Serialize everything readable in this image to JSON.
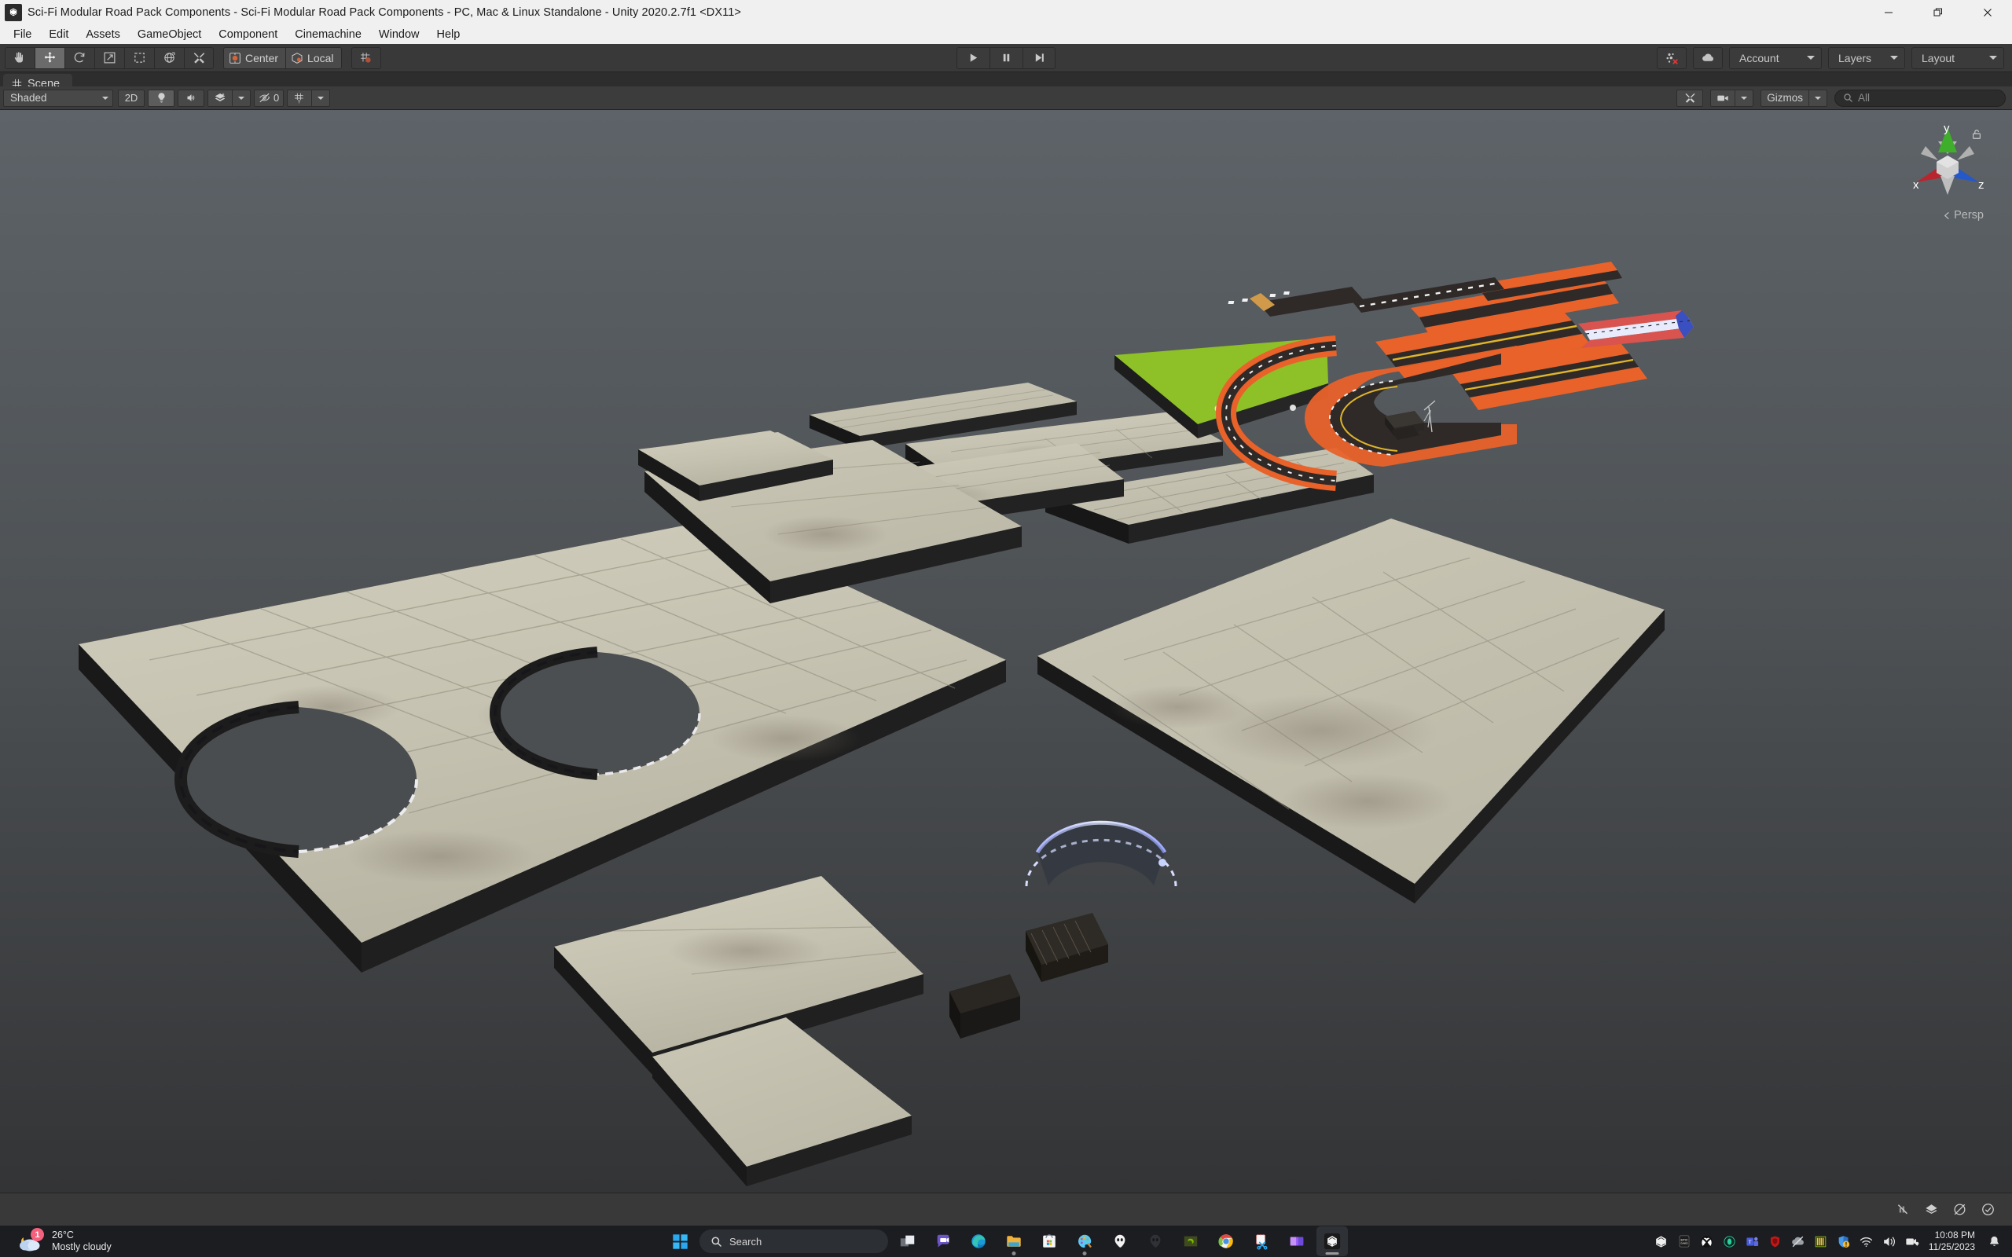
{
  "window": {
    "title": "Sci-Fi Modular Road Pack Components - Sci-Fi Modular Road Pack Components - PC, Mac & Linux Standalone - Unity 2020.2.7f1 <DX11>",
    "app_icon": "unity-icon",
    "controls": {
      "minimize": "minimize-icon",
      "restore": "restore-icon",
      "close": "close-icon"
    }
  },
  "menubar": {
    "items": [
      {
        "label": "File"
      },
      {
        "label": "Edit"
      },
      {
        "label": "Assets"
      },
      {
        "label": "GameObject"
      },
      {
        "label": "Component"
      },
      {
        "label": "Cinemachine"
      },
      {
        "label": "Window"
      },
      {
        "label": "Help"
      }
    ]
  },
  "toolbar": {
    "transform_tools": [
      {
        "name": "hand-tool",
        "icon": "hand-icon",
        "active": false
      },
      {
        "name": "move-tool",
        "icon": "move-icon",
        "active": true
      },
      {
        "name": "rotate-tool",
        "icon": "rotate-icon",
        "active": false
      },
      {
        "name": "scale-tool",
        "icon": "scale-icon",
        "active": false
      },
      {
        "name": "rect-tool",
        "icon": "rect-icon",
        "active": false
      },
      {
        "name": "transform-tool",
        "icon": "transform-icon",
        "active": false
      },
      {
        "name": "custom-tool",
        "icon": "wrench-icon",
        "active": false
      }
    ],
    "pivot_label": "Center",
    "handle_label": "Local",
    "grid_snap_icon": "grid-snap-icon",
    "play_controls": [
      {
        "name": "play-button",
        "icon": "play-icon"
      },
      {
        "name": "pause-button",
        "icon": "pause-icon"
      },
      {
        "name": "step-button",
        "icon": "step-icon"
      }
    ],
    "collab_icon": "collab-error-icon",
    "cloud_icon": "cloud-icon",
    "account_label": "Account",
    "layers_label": "Layers",
    "layout_label": "Layout"
  },
  "scene_tab": {
    "label": "Scene",
    "icon": "scene-grid-icon"
  },
  "scene_toolbar": {
    "draw_mode": "Shaded",
    "mode_2d": "2D",
    "lighting_icon": "lightbulb-icon",
    "audio_icon": "speaker-icon",
    "effects_icon": "effects-icon",
    "hidden_count": "0",
    "hidden_icon": "eye-off-icon",
    "grid_icon": "grid-visibility-icon",
    "tools_icon": "scene-tools-icon",
    "camera_icon": "camera-icon",
    "gizmos_label": "Gizmos",
    "search_placeholder": "All",
    "search_value": "",
    "search_icon": "search-icon"
  },
  "scene_gizmo": {
    "axis_x": "x",
    "axis_y": "y",
    "axis_z": "z",
    "projection": "Persp",
    "lock_icon": "lock-open-icon",
    "colors": {
      "x": "#b8252f",
      "y": "#3fae2a",
      "z": "#2558c9"
    }
  },
  "scene_objects": {
    "description": "Unity scene view showing a Sci-Fi Modular Road Pack: light grey concrete road modules laid out on a dark grey ground plane, plus an orange/black race-track module set, a green grass plot, a blue-lit curved barrier and small dark props.",
    "ground_color": "#4a4d50",
    "concrete_color": "#c9c5b4",
    "concrete_edge_color": "#1b1b1b",
    "track_orange": "#e8622a",
    "track_dark": "#3a3230",
    "grass_color": "#8ec127",
    "neon_blue": "#7c8cff"
  },
  "status_bar": {
    "icons": [
      {
        "name": "error-mute-icon"
      },
      {
        "name": "warning-collapse-icon"
      },
      {
        "name": "log-off-icon"
      },
      {
        "name": "ready-check-icon"
      }
    ]
  },
  "taskbar": {
    "weather": {
      "temperature": "26°C",
      "condition": "Mostly cloudy",
      "badge": "1",
      "icon": "partly-cloudy-night-icon"
    },
    "start_icon": "windows-start-icon",
    "search_placeholder": "Search",
    "search_icon": "search-icon",
    "apps": [
      {
        "name": "task-view-icon",
        "running": false
      },
      {
        "name": "chat-icon",
        "running": false
      },
      {
        "name": "edge-icon",
        "running": false
      },
      {
        "name": "file-explorer-icon",
        "running": true
      },
      {
        "name": "microsoft-store-icon",
        "running": false
      },
      {
        "name": "paint-icon",
        "running": true
      },
      {
        "name": "alienware-light-icon",
        "running": false
      },
      {
        "name": "alienware-dark-icon",
        "running": false
      },
      {
        "name": "nvidia-icon",
        "running": false
      },
      {
        "name": "chrome-icon",
        "running": false
      },
      {
        "name": "snipping-tool-icon",
        "running": false
      },
      {
        "name": "clipchamp-icon",
        "running": false
      },
      {
        "name": "unity-icon",
        "running": true,
        "active": true
      }
    ],
    "tray": [
      {
        "name": "unity-tray-icon"
      },
      {
        "name": "epic-games-tray-icon"
      },
      {
        "name": "xbox-tray-icon"
      },
      {
        "name": "alienware-tray-icon"
      },
      {
        "name": "teams-tray-icon"
      },
      {
        "name": "mcafee-tray-icon"
      },
      {
        "name": "onedrive-offline-tray-icon"
      },
      {
        "name": "intel-tray-icon"
      },
      {
        "name": "windows-security-tray-icon"
      },
      {
        "name": "wifi-tray-icon"
      },
      {
        "name": "volume-tray-icon"
      },
      {
        "name": "mobile-devices-tray-icon"
      }
    ],
    "time": "10:08 PM",
    "date": "11/25/2023",
    "notification_icon": "bell-icon"
  }
}
